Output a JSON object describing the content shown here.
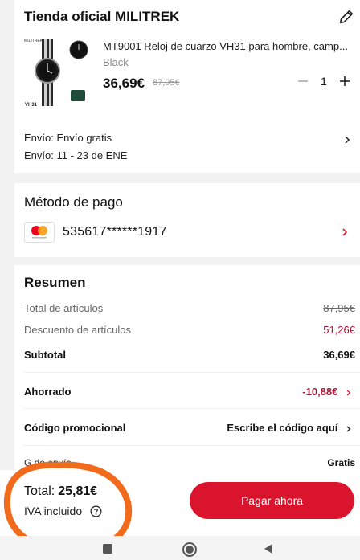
{
  "store": {
    "name": "Tienda oficial MILITREK",
    "product": {
      "title": "MT9001 Reloj de cuarzo VH31 para hombre, camp...",
      "variant": "Black",
      "price": "36,69€",
      "old_price": "87,95€",
      "image_label_brand": "MILITREK",
      "image_label_model": "VH31"
    },
    "quantity": "1",
    "shipping_method": "Envío: Envío gratis",
    "shipping_date": "Envío: 11 - 23 de ENE"
  },
  "payment": {
    "title": "Método de pago",
    "card_number": "535617******1917"
  },
  "summary": {
    "title": "Resumen",
    "rows": [
      {
        "label": "Total de artículos",
        "value": "87,95€"
      },
      {
        "label": "Descuento de artículos",
        "value": "51,26€"
      },
      {
        "label": "Subtotal",
        "value": "36,69€"
      },
      {
        "label": "Ahorrado",
        "value": "-10,88€"
      },
      {
        "label": "Código promocional",
        "value": "Escribe el código aquí"
      }
    ],
    "shipping_label_partial": "G        de envío",
    "shipping_value": "Gratis"
  },
  "footer": {
    "total_label": "Total:",
    "total_value": "25,81€",
    "vat_label": "IVA incluido",
    "pay_button_label": "Pagar ahora"
  },
  "colors": {
    "accent": "#d9142c",
    "discount_red": "#b0163a",
    "highlight_orange": "#f26a1b"
  },
  "icons": [
    "edit-icon",
    "chevron-right-icon",
    "minus-icon",
    "plus-icon",
    "mastercard-icon",
    "help-icon",
    "nav-recent-icon",
    "nav-home-icon",
    "nav-back-icon"
  ]
}
